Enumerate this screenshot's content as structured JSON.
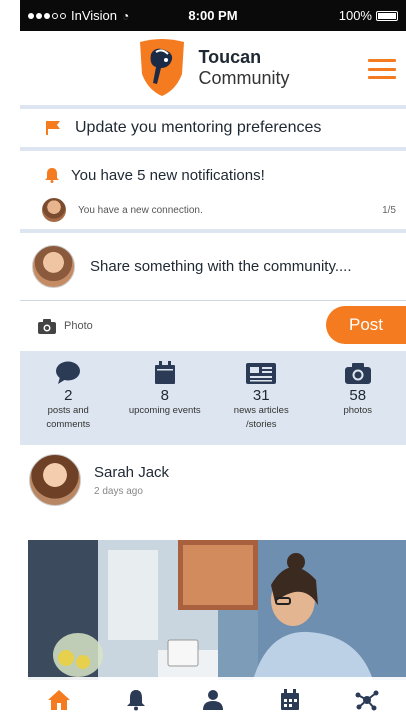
{
  "status_bar": {
    "carrier": "InVision",
    "time": "8:00 PM",
    "battery": "100%"
  },
  "header": {
    "title": "Toucan",
    "subtitle": "Community"
  },
  "mentoring": {
    "label": "Update you mentoring preferences"
  },
  "notifications": {
    "label": "You have 5 new notifications!",
    "item_text": "You have a new connection.",
    "pager": "1/5"
  },
  "composer": {
    "placeholder": "Share something with the community....",
    "photo_label": "Photo",
    "post_label": "Post"
  },
  "stats": [
    {
      "icon": "comment-icon",
      "value": "2",
      "label": "posts and comments"
    },
    {
      "icon": "calendar-icon",
      "value": "8",
      "label": "upcoming events"
    },
    {
      "icon": "newspaper-icon",
      "value": "31",
      "label": "news articles /stories"
    },
    {
      "icon": "camera-icon",
      "value": "58",
      "label": "photos"
    }
  ],
  "post": {
    "author": "Sarah Jack",
    "time": "2 days ago"
  },
  "tabs": [
    {
      "icon": "home-icon",
      "active": true
    },
    {
      "icon": "bell-icon",
      "active": false
    },
    {
      "icon": "person-icon",
      "active": false
    },
    {
      "icon": "calendar-icon",
      "active": false
    },
    {
      "icon": "network-icon",
      "active": false
    }
  ],
  "colors": {
    "accent": "#f47b20",
    "navy": "#2b3a55",
    "panel": "#dde6f0"
  }
}
